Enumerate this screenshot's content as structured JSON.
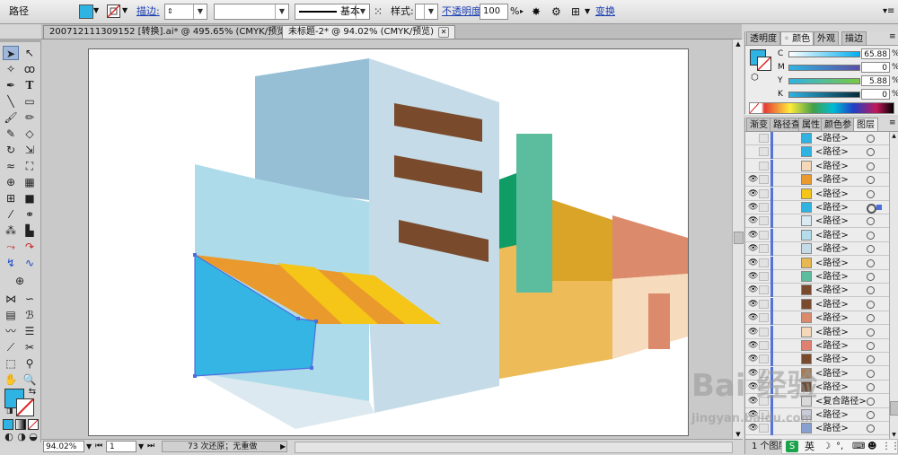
{
  "control_bar": {
    "object_type": "路径",
    "fill_color": "#2fb3e3",
    "stroke_label": "描边:",
    "stroke_value": "",
    "brush_label": "基本",
    "style_label": "样式:",
    "opacity_label": "不透明度:",
    "opacity_value": "100",
    "opacity_unit": "%",
    "transform_label": "变换"
  },
  "tabs": [
    {
      "label": "2007121113091​52 [转换].ai* @ 495.65% (CMYK/预览)"
    },
    {
      "label": "未标题-2* @ 94.02% (CMYK/预览)"
    }
  ],
  "status": {
    "zoom": "94.02%",
    "page": "1",
    "history": "73 次还原；无重做"
  },
  "color_panel": {
    "tabs": [
      "透明度",
      "颜色",
      "外观",
      "描边"
    ],
    "active_tab": "颜色",
    "channels": [
      {
        "label": "C",
        "value": "65.88",
        "unit": "%"
      },
      {
        "label": "M",
        "value": "0",
        "unit": "%"
      },
      {
        "label": "Y",
        "value": "5.88",
        "unit": "%"
      },
      {
        "label": "K",
        "value": "0",
        "unit": "%"
      }
    ]
  },
  "layers_panel": {
    "tabs": [
      "渐变",
      "路径查",
      "属性",
      "颜色参",
      "图层"
    ],
    "active_tab": "图层",
    "rows": [
      {
        "name": "<路径>",
        "eye": false,
        "thumb": "#2fb3e3"
      },
      {
        "name": "<路径>",
        "eye": false,
        "thumb": "#2fb3e3"
      },
      {
        "name": "<路径>",
        "eye": false,
        "thumb": "#f4d8b8"
      },
      {
        "name": "<路径>",
        "eye": true,
        "thumb": "#ea9a2c"
      },
      {
        "name": "<路径>",
        "eye": true,
        "thumb": "#f5c518"
      },
      {
        "name": "<路径>",
        "eye": true,
        "thumb": "#2fb3e3"
      },
      {
        "name": "<路径>",
        "eye": true,
        "thumb": "#d9eaf2"
      },
      {
        "name": "<路径>",
        "eye": true,
        "thumb": "#b4dceb"
      },
      {
        "name": "<路径>",
        "eye": true,
        "thumb": "#c5dce8"
      },
      {
        "name": "<路径>",
        "eye": true,
        "thumb": "#e7b84f"
      },
      {
        "name": "<路径>",
        "eye": true,
        "thumb": "#5bbd9e"
      },
      {
        "name": "<路径>",
        "eye": true,
        "thumb": "#7a4a2c"
      },
      {
        "name": "<路径>",
        "eye": true,
        "thumb": "#7a4a2c"
      },
      {
        "name": "<路径>",
        "eye": true,
        "thumb": "#dc8a6c"
      },
      {
        "name": "<路径>",
        "eye": true,
        "thumb": "#f4d8b8"
      },
      {
        "name": "<路径>",
        "eye": true,
        "thumb": "#e08070"
      },
      {
        "name": "<路径>",
        "eye": true,
        "thumb": "#7a4a2c"
      },
      {
        "name": "<路径>",
        "eye": true,
        "thumb": "#a77b55"
      },
      {
        "name": "<路径>",
        "eye": true,
        "thumb": "#6b4a33"
      },
      {
        "name": "<复合路径>",
        "eye": true,
        "thumb": "#d9d9d9"
      },
      {
        "name": "<路径>",
        "eye": true,
        "thumb": "#c9ccd8"
      },
      {
        "name": "<路径>",
        "eye": true,
        "thumb": "#88a0d0"
      }
    ],
    "footer": "1 个图层"
  },
  "watermark": {
    "line1": "Bai 经验",
    "line2": "jingyan.baidu.com",
    "ime": "英"
  },
  "colors": {
    "accent": "#2fb3e3",
    "selection": "#4c6fe0"
  }
}
